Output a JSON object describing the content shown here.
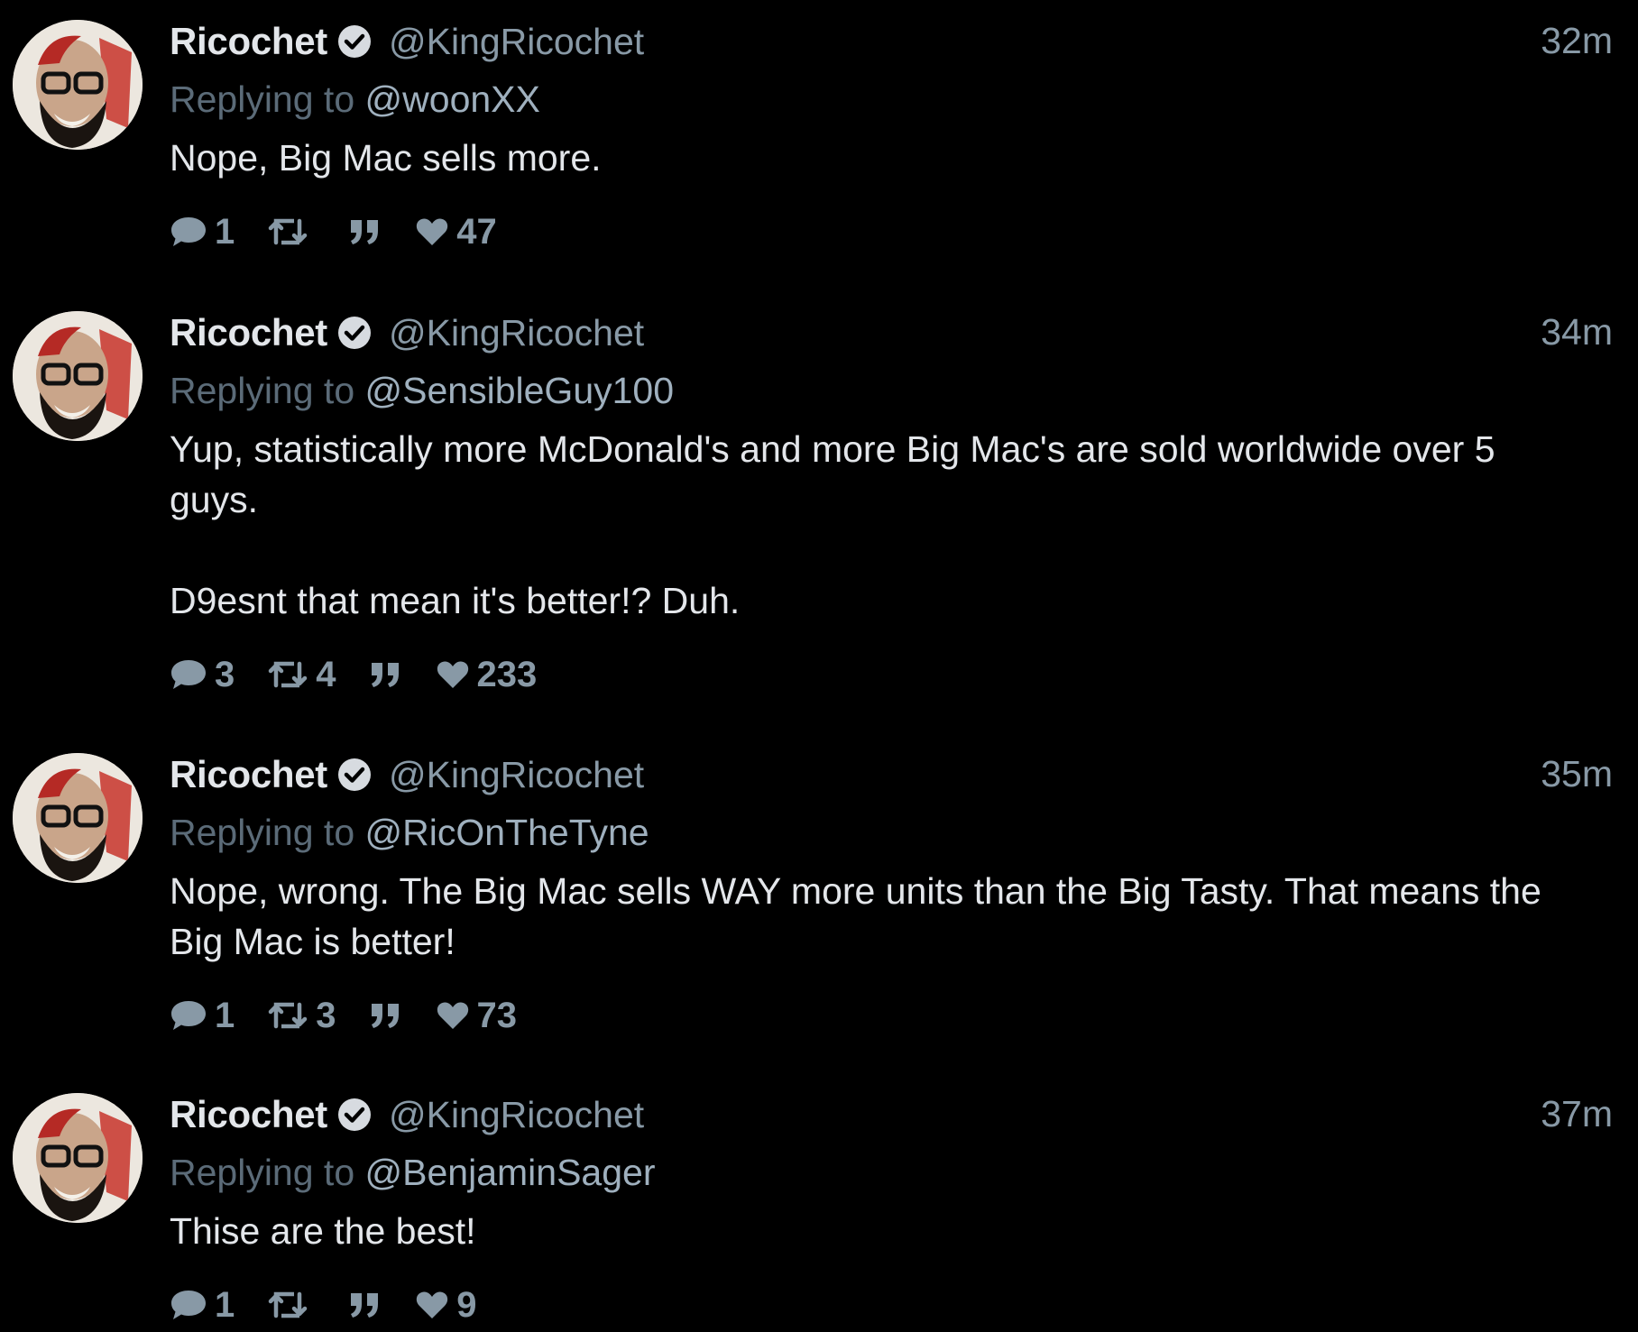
{
  "colors": {
    "background": "#000000",
    "text": "#e3e6ea",
    "muted": "#8899a6",
    "verified": "#ffffff"
  },
  "tweets": [
    {
      "name": "Ricochet",
      "handle": "@KingRicochet",
      "time": "32m",
      "replying_prefix": "Replying to",
      "replying_to": "@woonXX",
      "text": "Nope, Big Mac sells more.",
      "replies": "1",
      "retweets": "",
      "likes": "47"
    },
    {
      "name": "Ricochet",
      "handle": "@KingRicochet",
      "time": "34m",
      "replying_prefix": "Replying to",
      "replying_to": "@SensibleGuy100",
      "text": "Yup, statistically more McDonald's and more Big Mac's are sold worldwide over 5\nguys.\n\nD9esnt that mean it's better!? Duh.",
      "replies": "3",
      "retweets": "4",
      "likes": "233"
    },
    {
      "name": "Ricochet",
      "handle": "@KingRicochet",
      "time": "35m",
      "replying_prefix": "Replying to",
      "replying_to": "@RicOnTheTyne",
      "text": "Nope, wrong. The Big Mac sells WAY more units than the Big Tasty. That means the\nBig Mac is better!",
      "replies": "1",
      "retweets": "3",
      "likes": "73"
    },
    {
      "name": "Ricochet",
      "handle": "@KingRicochet",
      "time": "37m",
      "replying_prefix": "Replying to",
      "replying_to": "@BenjaminSager",
      "text": "Thise are the best!",
      "replies": "1",
      "retweets": "",
      "likes": "9"
    }
  ]
}
